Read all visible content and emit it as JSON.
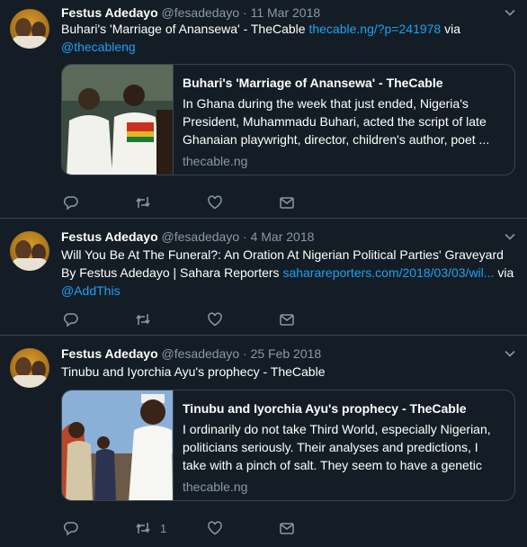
{
  "colors": {
    "background": "#141d26",
    "link": "#1da1f2",
    "muted": "#8899a6",
    "border": "#38444d"
  },
  "icons": {
    "reply": "reply-icon",
    "retweet": "retweet-icon",
    "like": "heart-icon",
    "dm": "envelope-icon",
    "menu": "chevron-down-icon"
  },
  "tweets": [
    {
      "name": "Festus Adedayo",
      "handle": "@fesadedayo",
      "dot": "·",
      "date": "11 Mar 2018",
      "text_before": "Buhari's 'Marriage of Anansewa' - TheCable ",
      "link": "thecable.ng/?p=241978",
      "text_after": " via ",
      "mention": "@thecableng",
      "card": {
        "title": "Buhari's 'Marriage of Anansewa' - TheCable",
        "description": "In Ghana during the week that just ended, Nigeria's President, Muhammadu Buhari, acted the script of late Ghanaian playwright, director, children's author, poet ...",
        "domain": "thecable.ng"
      },
      "retweet_count": ""
    },
    {
      "name": "Festus Adedayo",
      "handle": "@fesadedayo",
      "dot": "·",
      "date": "4 Mar 2018",
      "text_before": "Will You Be At The Funeral?: An Oration At Nigerian Political Parties' Graveyard By Festus Adedayo | Sahara Reporters ",
      "link": "saharareporters.com/2018/03/03/wil...",
      "text_after": " via ",
      "mention": "@AddThis",
      "retweet_count": ""
    },
    {
      "name": "Festus Adedayo",
      "handle": "@fesadedayo",
      "dot": "·",
      "date": "25 Feb 2018",
      "text_before": "Tinubu and Iyorchia Ayu's prophecy - TheCable",
      "card": {
        "title": "Tinubu and Iyorchia Ayu's prophecy - TheCable",
        "description": "I ordinarily do not take Third World, especially Nigerian, politicians seriously. Their analyses and predictions, I take with a pinch of salt. They seem to have a genetic dy...",
        "domain": "thecable.ng"
      },
      "retweet_count": "1"
    }
  ]
}
